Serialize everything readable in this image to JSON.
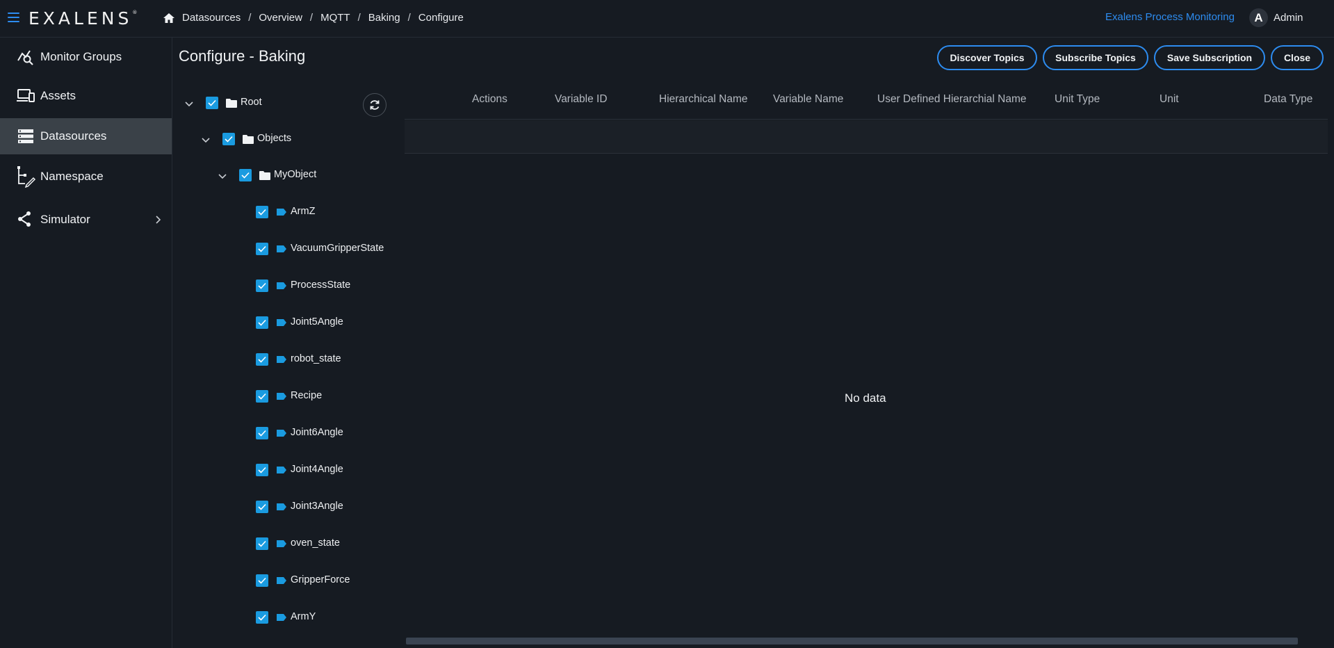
{
  "topbar": {
    "logo": "EXALENS",
    "logo_mark": "®",
    "breadcrumb": [
      "Datasources",
      "Overview",
      "MQTT",
      "Baking",
      "Configure"
    ],
    "app_link": "Exalens Process Monitoring",
    "user_initial": "A",
    "user_name": "Admin"
  },
  "sidebar": {
    "items": [
      {
        "label": "Monitor Groups",
        "icon": "monitor-groups-icon"
      },
      {
        "label": "Assets",
        "icon": "assets-icon"
      },
      {
        "label": "Datasources",
        "icon": "datasources-icon",
        "active": true
      },
      {
        "label": "Namespace",
        "icon": "namespace-icon"
      },
      {
        "label": "Simulator",
        "icon": "simulator-icon",
        "has_submenu": true
      }
    ]
  },
  "main": {
    "title": "Configure - Baking",
    "buttons": {
      "discover": "Discover Topics",
      "subscribe": "Subscribe Topics",
      "save": "Save Subscription",
      "close": "Close"
    },
    "tree": {
      "root": "Root",
      "objects": "Objects",
      "my_object": "MyObject",
      "tags": [
        "ArmZ",
        "VacuumGripperState",
        "ProcessState",
        "Joint5Angle",
        "robot_state",
        "Recipe",
        "Joint6Angle",
        "Joint4Angle",
        "Joint3Angle",
        "oven_state",
        "GripperForce",
        "ArmY"
      ]
    },
    "table": {
      "columns": [
        "Actions",
        "Variable ID",
        "Hierarchical Name",
        "Variable Name",
        "User Defined Hierarchial Name",
        "Unit Type",
        "Unit",
        "Data Type"
      ],
      "empty_text": "No data"
    }
  },
  "colors": {
    "accent": "#2d8cf0",
    "checkbox": "#1a9be0",
    "background": "#161b22",
    "active_nav": "#3a4148"
  }
}
